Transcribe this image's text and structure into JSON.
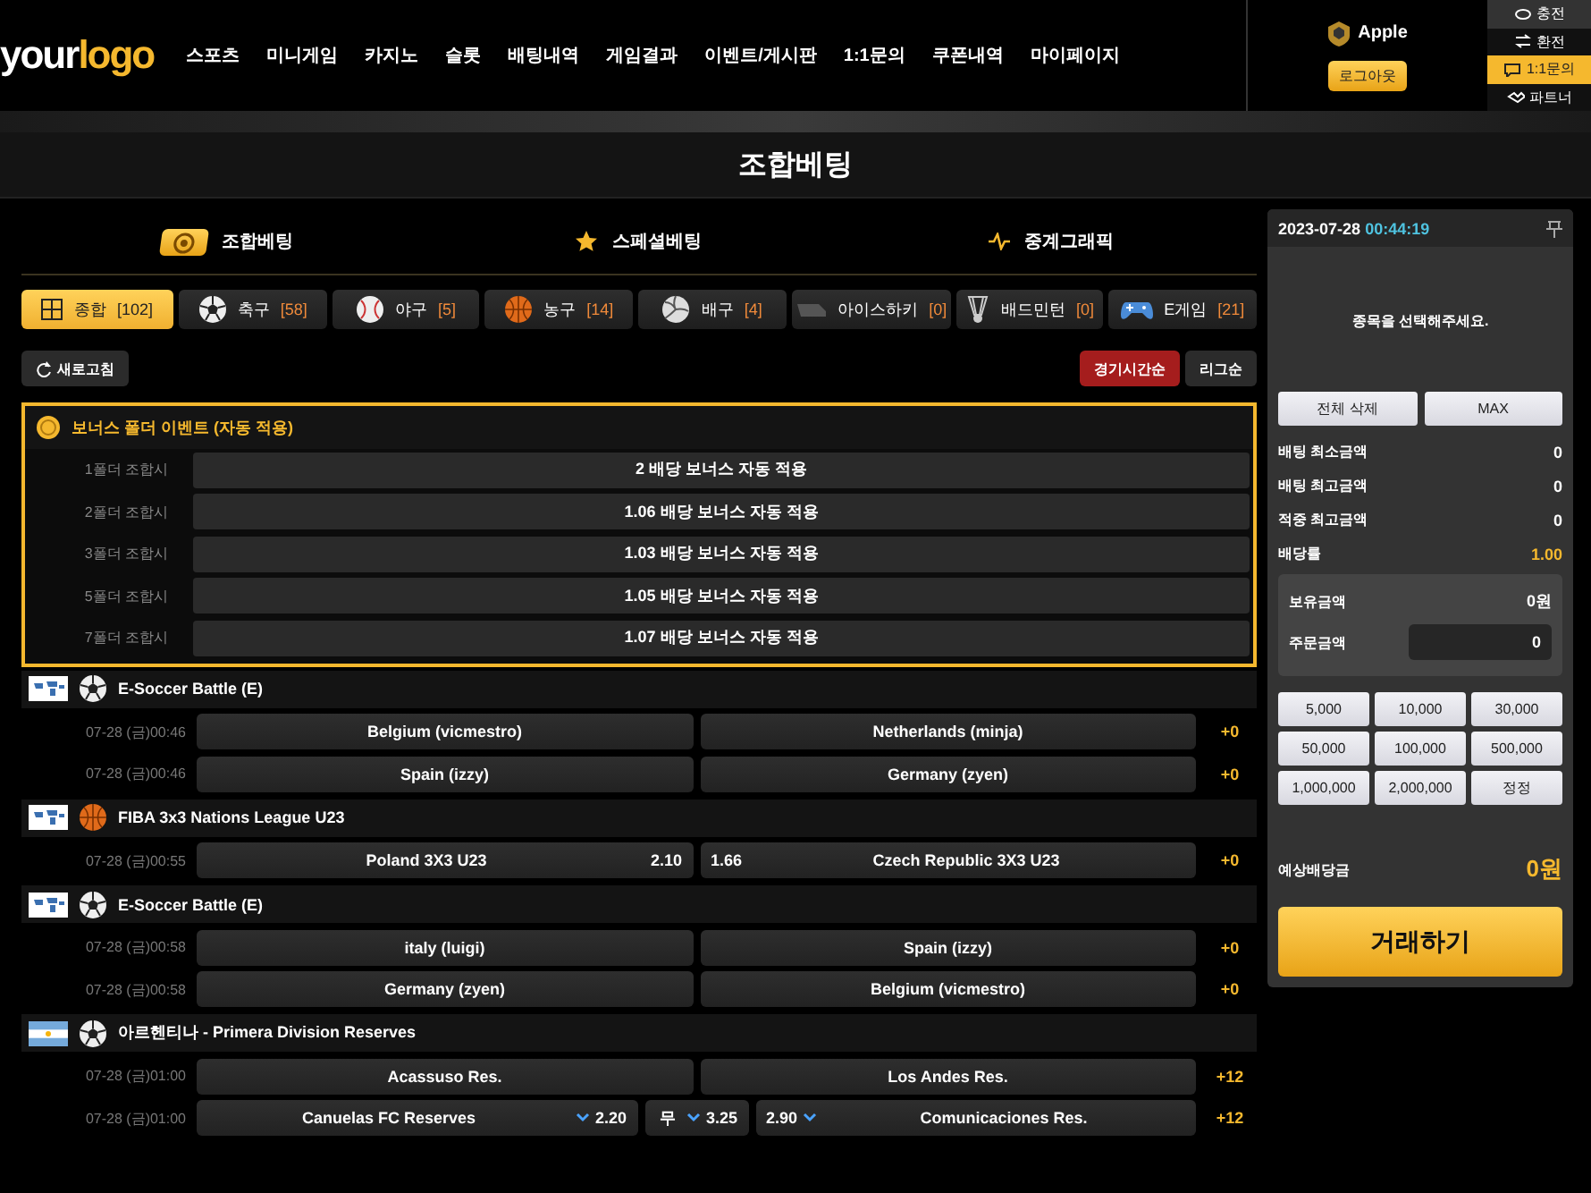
{
  "header": {
    "logo": [
      "your",
      "logo"
    ],
    "nav": [
      "스포츠",
      "미니게임",
      "카지노",
      "슬롯",
      "배팅내역",
      "게임결과",
      "이벤트/게시판",
      "1:1문의",
      "쿠폰내역",
      "마이페이지"
    ],
    "user": {
      "name": "Apple",
      "logout": "로그아웃"
    },
    "side_links": [
      {
        "label": "충전",
        "kind": "charge",
        "selected": false
      },
      {
        "label": "환전",
        "kind": "exchange",
        "selected": false
      },
      {
        "label": "1:1문의",
        "kind": "chat",
        "selected": true
      },
      {
        "label": "파트너",
        "kind": "partner",
        "selected": false
      }
    ]
  },
  "page_title": "조합베팅",
  "mode_tabs": [
    {
      "label": "조합베팅",
      "kind": "ball",
      "selected": true
    },
    {
      "label": "스페셜베팅",
      "kind": "star",
      "selected": false
    },
    {
      "label": "중계그래픽",
      "kind": "pulse",
      "selected": false
    }
  ],
  "sport_tabs": [
    {
      "label": "종합",
      "count": "[102]",
      "kind": "all",
      "selected": true
    },
    {
      "label": "축구",
      "count": "[58]",
      "kind": "soccer",
      "selected": false
    },
    {
      "label": "야구",
      "count": "[5]",
      "kind": "baseball",
      "selected": false
    },
    {
      "label": "농구",
      "count": "[14]",
      "kind": "basketball",
      "selected": false
    },
    {
      "label": "배구",
      "count": "[4]",
      "kind": "volleyball",
      "selected": false
    },
    {
      "label": "아이스하키",
      "count": "[0]",
      "kind": "hockey",
      "selected": false
    },
    {
      "label": "배드민턴",
      "count": "[0]",
      "kind": "badminton",
      "selected": false
    },
    {
      "label": "E게임",
      "count": "[21]",
      "kind": "egame",
      "selected": false
    }
  ],
  "refresh": "새로고침",
  "sort_buttons": [
    {
      "label": "경기시간순",
      "selected": true
    },
    {
      "label": "리그순",
      "selected": false
    }
  ],
  "bonus": {
    "title": "보너스 폴더 이벤트 (자동 적용)",
    "rows": [
      {
        "condition": "1폴더 조합시",
        "text": "2 배당 보너스 자동 적용"
      },
      {
        "condition": "2폴더 조합시",
        "text": "1.06 배당 보너스 자동 적용"
      },
      {
        "condition": "3폴더 조합시",
        "text": "1.03 배당 보너스 자동 적용"
      },
      {
        "condition": "5폴더 조합시",
        "text": "1.05 배당 보너스 자동 적용"
      },
      {
        "condition": "7폴더 조합시",
        "text": "1.07 배당 보너스 자동 적용"
      }
    ]
  },
  "leagues": [
    {
      "name": "E-Soccer Battle (E)",
      "icons": [
        {
          "kind": "world"
        },
        {
          "kind": "soccer"
        }
      ],
      "matches": [
        {
          "time": "07-28 (금)00:46",
          "home": "Belgium (vicmestro)",
          "away": "Netherlands (minja)",
          "more": "+0"
        },
        {
          "time": "07-28 (금)00:46",
          "home": "Spain (izzy)",
          "away": "Germany (zyen)",
          "more": "+0"
        }
      ]
    },
    {
      "name": "FIBA 3x3 Nations League U23",
      "icons": [
        {
          "kind": "world"
        },
        {
          "kind": "basketball"
        }
      ],
      "matches": [
        {
          "time": "07-28 (금)00:55",
          "home": "Poland 3X3 U23",
          "home_odds": {
            "value": "2.10"
          },
          "away_odds": {
            "value": "1.66"
          },
          "away": "Czech Republic 3X3 U23",
          "more": "+0"
        }
      ]
    },
    {
      "name": "E-Soccer Battle (E)",
      "icons": [
        {
          "kind": "world"
        },
        {
          "kind": "soccer"
        }
      ],
      "matches": [
        {
          "time": "07-28 (금)00:58",
          "home": "italy (luigi)",
          "away": "Spain (izzy)",
          "more": "+0"
        },
        {
          "time": "07-28 (금)00:58",
          "home": "Germany (zyen)",
          "away": "Belgium (vicmestro)",
          "more": "+0"
        }
      ]
    },
    {
      "name": "아르헨티나 - Primera Division Reserves",
      "icons": [
        {
          "kind": "argentina"
        },
        {
          "kind": "soccer"
        }
      ],
      "matches": [
        {
          "time": "07-28 (금)01:00",
          "home": "Acassuso Res.",
          "away": "Los Andes Res.",
          "more": "+12"
        },
        {
          "time": "07-28 (금)01:00",
          "home": "Canuelas FC Reserves",
          "home_odds": {
            "value": "2.20",
            "kind": "down"
          },
          "draw": {
            "label": "무",
            "value": "3.25",
            "kind": "down"
          },
          "away_odds": {
            "value": "2.90",
            "kind": "down"
          },
          "away": "Comunicaciones Res.",
          "more": "+12"
        }
      ]
    }
  ],
  "slip": {
    "date": "2023-07-28",
    "time": "00:44:19",
    "empty": "종목을 선택해주세요.",
    "buttons": [
      "전체 삭제",
      "MAX"
    ],
    "stats": [
      {
        "label": "배팅 최소금액",
        "value": "0",
        "highlight": false
      },
      {
        "label": "배팅 최고금액",
        "value": "0",
        "highlight": false
      },
      {
        "label": "적중 최고금액",
        "value": "0",
        "highlight": false
      },
      {
        "label": "배당률",
        "value": "1.00",
        "highlight": true
      }
    ],
    "balance": {
      "label": "보유금액",
      "value": "0원"
    },
    "order": {
      "label": "주문금액",
      "value": "0"
    },
    "amounts": [
      "5,000",
      "10,000",
      "30,000",
      "50,000",
      "100,000",
      "500,000",
      "1,000,000",
      "2,000,000",
      "정정"
    ],
    "expected": {
      "label": "예상배당금",
      "value": "0원"
    },
    "submit": "거래하기"
  }
}
